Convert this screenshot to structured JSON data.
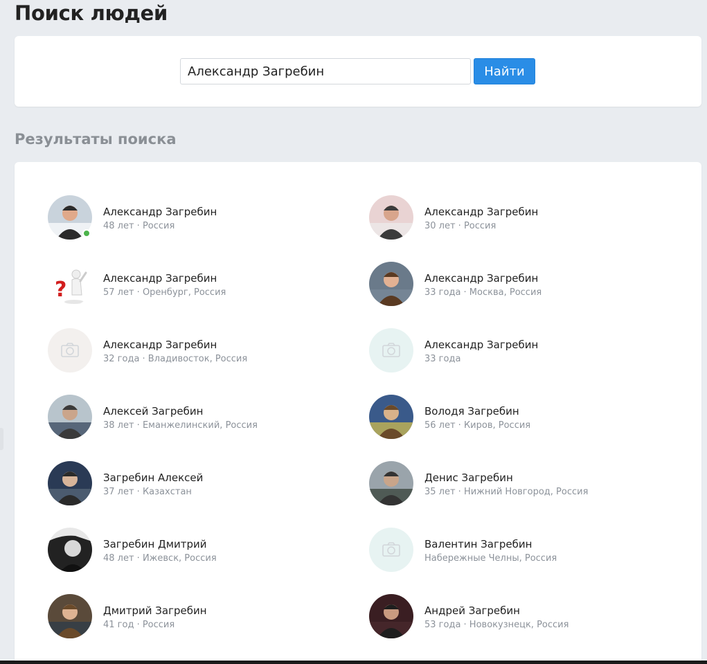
{
  "page": {
    "title": "Поиск людей"
  },
  "search": {
    "query": "Александр Загребин",
    "button_label": "Найти"
  },
  "results": {
    "title": "Результаты поиска",
    "people": [
      {
        "name": "Александр Загребин",
        "meta": "48 лет · Россия",
        "avatar": "photo-man-portrait",
        "online": true
      },
      {
        "name": "Александр Загребин",
        "meta": "30 лет · Россия",
        "avatar": "photo-man-press-wall",
        "online": false
      },
      {
        "name": "Александр Загребин",
        "meta": "57 лет · Оренбург, Россия",
        "avatar": "question-figure",
        "online": false
      },
      {
        "name": "Александр Загребин",
        "meta": "33 года · Москва, Россия",
        "avatar": "photo-man-with-child",
        "online": false
      },
      {
        "name": "Александр Загребин",
        "meta": "32 года · Владивосток, Россия",
        "avatar": "camera-placeholder-beige",
        "online": false
      },
      {
        "name": "Александр Загребин",
        "meta": "33 года",
        "avatar": "camera-placeholder-teal",
        "online": false
      },
      {
        "name": "Алексей Загребин",
        "meta": "38 лет · Еманжелинский, Россия",
        "avatar": "photo-man-outdoors",
        "online": false
      },
      {
        "name": "Володя Загребин",
        "meta": "56 лет · Киров, Россия",
        "avatar": "photo-man-seated",
        "online": false
      },
      {
        "name": "Загребин Алексей",
        "meta": "37 лет · Казахстан",
        "avatar": "photo-man-office",
        "online": false
      },
      {
        "name": "Денис Загребин",
        "meta": "35 лет · Нижний Новгород, Россия",
        "avatar": "photo-man-landscape",
        "online": false
      },
      {
        "name": "Загребин Дмитрий",
        "meta": "48 лет · Ижевск, Россия",
        "avatar": "photo-bw-portrait",
        "online": false
      },
      {
        "name": "Валентин Загребин",
        "meta": "Набережные Челны, Россия",
        "avatar": "camera-placeholder-teal",
        "online": false
      },
      {
        "name": "Дмитрий Загребин",
        "meta": "41 год · Россия",
        "avatar": "photo-man-microphone",
        "online": false
      },
      {
        "name": "Андрей Загребин",
        "meta": "53 года · Новокузнецк, Россия",
        "avatar": "photo-man-dark",
        "online": false
      }
    ]
  },
  "colors": {
    "accent": "#2a8de6",
    "background": "#e9ecf0",
    "online": "#4bb34b",
    "placeholder_beige": "#f3f0ee",
    "placeholder_teal": "#e7f3f2"
  }
}
